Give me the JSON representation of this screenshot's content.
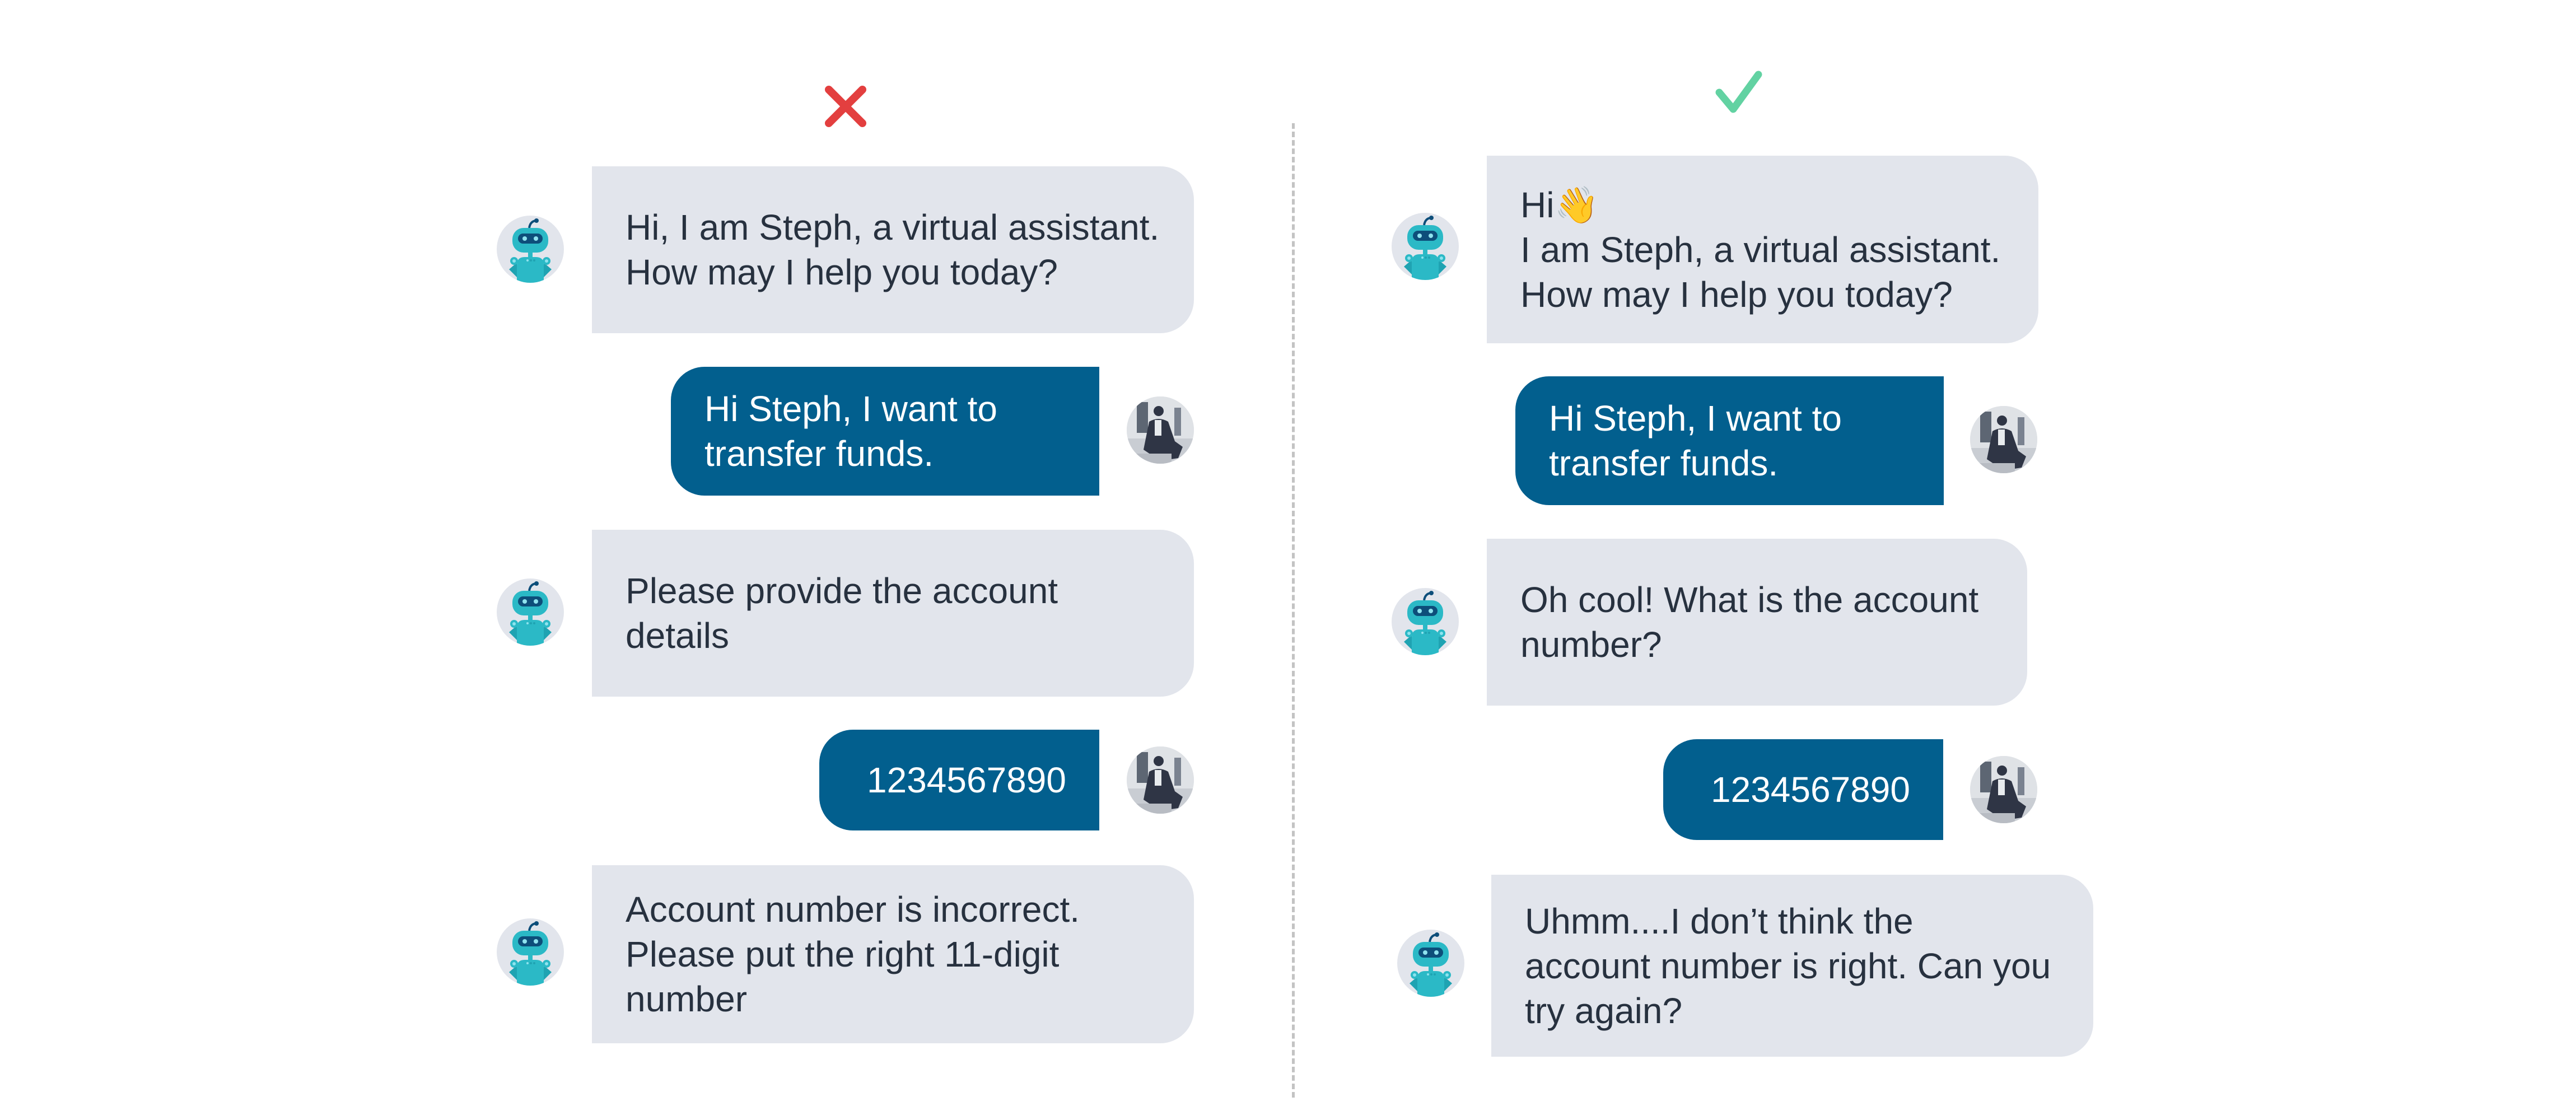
{
  "bad_example": {
    "marker_icon": "cross-icon",
    "marker_color": "#e33f3f",
    "messages": [
      {
        "sender": "bot",
        "lines": [
          "Hi, I am Steph, a virtual assistant.",
          "How may I help you today?"
        ]
      },
      {
        "sender": "user",
        "lines": [
          "Hi Steph, I want to",
          "transfer funds."
        ]
      },
      {
        "sender": "bot",
        "lines": [
          "Please provide the account",
          "details"
        ]
      },
      {
        "sender": "user",
        "lines": [
          "1234567890"
        ]
      },
      {
        "sender": "bot",
        "lines": [
          "Account number is incorrect.",
          "Please put the right 11-digit",
          "number"
        ]
      }
    ]
  },
  "good_example": {
    "marker_icon": "checkmark-icon",
    "marker_color": "#62d2a2",
    "messages": [
      {
        "sender": "bot",
        "lines": [
          "Hi👋",
          "I am Steph, a virtual assistant.",
          "How may I help you today?"
        ]
      },
      {
        "sender": "user",
        "lines": [
          "Hi Steph, I want to",
          "transfer funds."
        ]
      },
      {
        "sender": "bot",
        "lines": [
          "Oh cool! What is the account",
          "number?"
        ]
      },
      {
        "sender": "user",
        "lines": [
          "1234567890"
        ]
      },
      {
        "sender": "bot",
        "lines": [
          "Uhmm....I don’t think the",
          "account number is right. Can you",
          "try again?"
        ]
      }
    ]
  },
  "colors": {
    "bot_bubble": "#e2e5ec",
    "user_bubble": "#025f8e",
    "bot_text": "#27313f",
    "user_text": "#ffffff"
  }
}
